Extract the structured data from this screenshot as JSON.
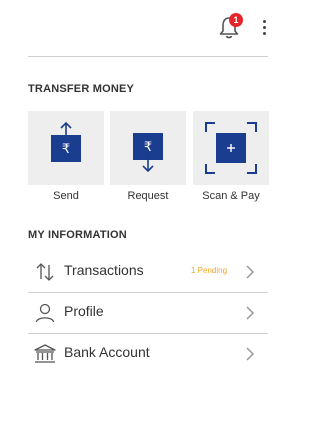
{
  "header": {
    "notification_count": "1"
  },
  "transfer": {
    "title": "TRANSFER MONEY",
    "tiles": [
      {
        "label": "Send",
        "icon": "rupee-send-icon"
      },
      {
        "label": "Request",
        "icon": "rupee-request-icon"
      },
      {
        "label": "Scan & Pay",
        "icon": "scan-icon"
      }
    ]
  },
  "info": {
    "title": "MY INFORMATION",
    "rows": [
      {
        "label": "Transactions",
        "badge": "1 Pending",
        "icon": "transactions-icon"
      },
      {
        "label": "Profile",
        "icon": "user-icon"
      },
      {
        "label": "Bank Account",
        "icon": "bank-icon"
      }
    ]
  },
  "colors": {
    "brand": "#1a3d8f",
    "badge": "#e8242b",
    "pending": "#f5a623"
  }
}
